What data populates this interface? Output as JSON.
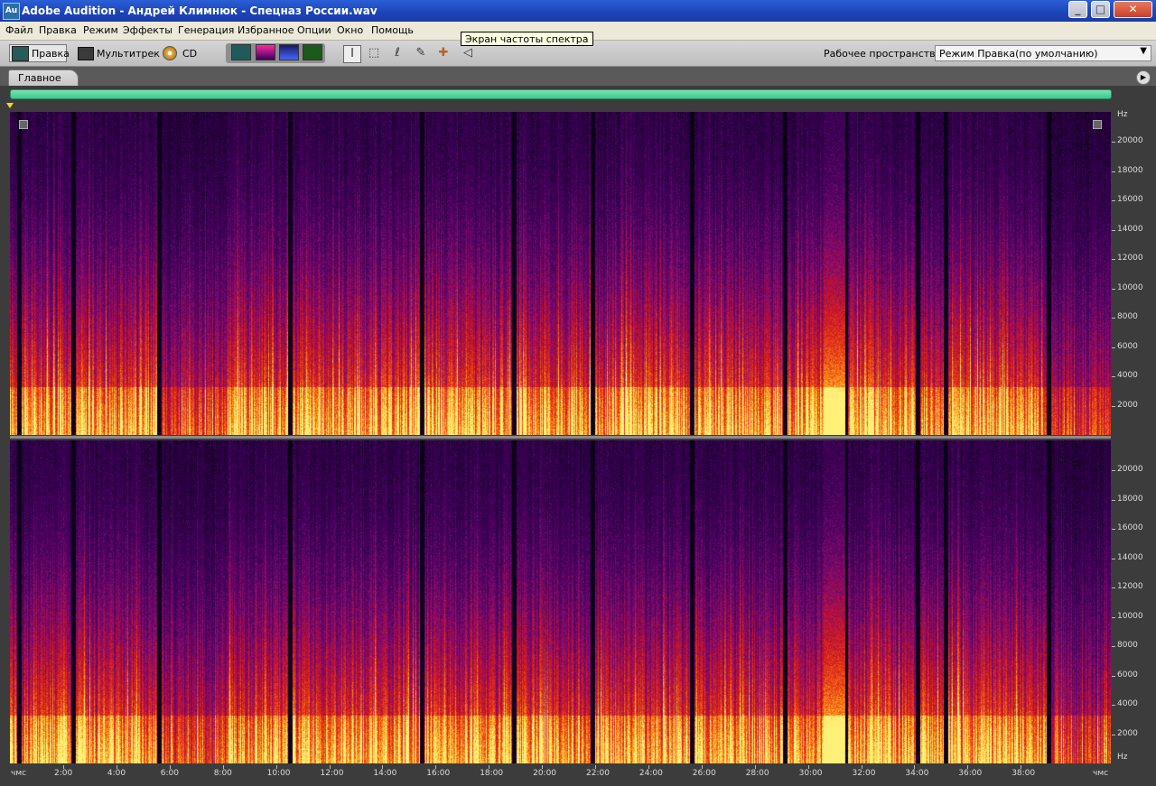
{
  "window": {
    "icon": "Au",
    "title": "Adobe Audition - Андрей Климнюк - Спецназ России.wav",
    "min_label": "_",
    "max_label": "□",
    "close_label": "✕"
  },
  "menu": [
    "Файл",
    "Правка",
    "Режим",
    "Эффекты",
    "Генерация",
    "Избранное",
    "Опции",
    "Окно",
    "Помощь"
  ],
  "toolbar": {
    "edit_label": "Правка",
    "multitrack_label": "Мультитрек",
    "cd_label": "CD",
    "workspace_label": "Рабочее пространство:",
    "workspace_value": "Режим Правка(по умолчанию)"
  },
  "tooltip": "Экран частоты спектра",
  "panel": {
    "tab_label": "Главное"
  },
  "freq_axis": {
    "unit": "Hz",
    "ticks": [
      "20000",
      "18000",
      "16000",
      "14000",
      "12000",
      "10000",
      "8000",
      "6000",
      "4000",
      "2000"
    ]
  },
  "time_axis": {
    "unit": "чмс",
    "ticks": [
      "2:00",
      "4:00",
      "6:00",
      "8:00",
      "10:00",
      "12:00",
      "14:00",
      "16:00",
      "18:00",
      "20:00",
      "22:00",
      "24:00",
      "26:00",
      "28:00",
      "30:00",
      "32:00",
      "34:00",
      "36:00",
      "38:00"
    ]
  },
  "colors": {
    "spectro_low": "#1a0033",
    "spectro_mid": "#c01a1a",
    "spectro_high": "#ffe45a",
    "overview_bar": "#4fd69c"
  }
}
